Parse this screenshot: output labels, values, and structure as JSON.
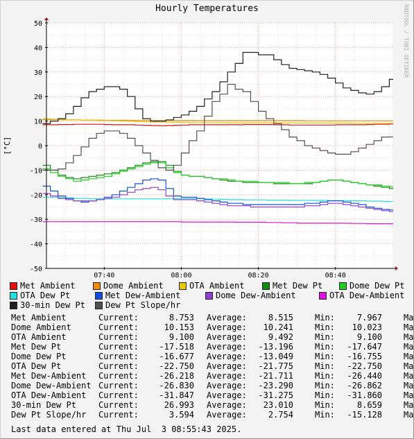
{
  "title": "Hourly Temperatures",
  "credit": "RRDTOOL / TOBI OETIKER",
  "ylabel": "[°C]",
  "colors": {
    "background": "#f3f3f3",
    "plot_background": "#ffffff",
    "grid_major": "#f0a8a8",
    "grid_minor": "#e0e0e0",
    "axis": "#000000",
    "arrow": "#a01010"
  },
  "chart_data": {
    "type": "line",
    "title": "Hourly Temperatures",
    "ylabel": "[°C]",
    "ylim": [
      -50,
      50
    ],
    "yticks": [
      50,
      40,
      30,
      20,
      10,
      0,
      -10,
      -20,
      -30,
      -40,
      -50
    ],
    "xrange": [
      "07:25",
      "08:55"
    ],
    "xticks": [
      "07:40",
      "08:00",
      "08:20",
      "08:40"
    ],
    "grid": true,
    "x": [
      "07:25",
      "07:27",
      "07:29",
      "07:31",
      "07:33",
      "07:35",
      "07:37",
      "07:39",
      "07:41",
      "07:43",
      "07:45",
      "07:47",
      "07:49",
      "07:51",
      "07:53",
      "07:55",
      "07:57",
      "07:59",
      "08:01",
      "08:03",
      "08:05",
      "08:07",
      "08:09",
      "08:11",
      "08:13",
      "08:15",
      "08:17",
      "08:19",
      "08:21",
      "08:23",
      "08:25",
      "08:27",
      "08:29",
      "08:31",
      "08:33",
      "08:35",
      "08:37",
      "08:39",
      "08:41",
      "08:43",
      "08:45",
      "08:47",
      "08:49",
      "08:51",
      "08:53",
      "08:55"
    ],
    "series": [
      {
        "name": "Met Ambient",
        "color": "#e01010",
        "values": [
          8.5,
          8.5,
          8.6,
          8.6,
          8.7,
          8.7,
          8.7,
          8.7,
          8.6,
          8.5,
          8.5,
          8.5,
          8.4,
          8.3,
          8.2,
          8.1,
          8.2,
          8.3,
          8.4,
          8.5,
          8.5,
          8.5,
          8.5,
          8.5,
          8.5,
          8.5,
          8.6,
          8.6,
          8.6,
          8.6,
          8.5,
          8.5,
          8.4,
          8.4,
          8.4,
          8.4,
          8.4,
          8.4,
          8.5,
          8.5,
          8.5,
          8.5,
          8.6,
          8.7,
          8.7,
          8.8
        ]
      },
      {
        "name": "Dome Ambient",
        "color": "#f08a10",
        "values": [
          10.6,
          10.6,
          10.5,
          10.5,
          10.5,
          10.4,
          10.4,
          10.4,
          10.3,
          10.3,
          10.3,
          10.3,
          10.2,
          10.2,
          10.2,
          10.2,
          10.2,
          10.2,
          10.2,
          10.2,
          10.2,
          10.2,
          10.2,
          10.2,
          10.2,
          10.2,
          10.2,
          10.2,
          10.2,
          10.2,
          10.2,
          10.2,
          10.2,
          10.2,
          10.1,
          10.1,
          10.1,
          10.1,
          10.1,
          10.1,
          10.1,
          10.1,
          10.1,
          10.1,
          10.1,
          10.1
        ]
      },
      {
        "name": "OTA Ambient",
        "color": "#e8c800",
        "values": [
          10.9,
          10.8,
          10.7,
          10.6,
          10.5,
          10.4,
          10.3,
          10.2,
          10.2,
          10.1,
          10.0,
          9.9,
          9.8,
          9.7,
          9.6,
          9.6,
          9.5,
          9.5,
          9.5,
          9.4,
          9.4,
          9.4,
          9.4,
          9.4,
          9.3,
          9.3,
          9.3,
          9.3,
          9.3,
          9.3,
          9.3,
          9.3,
          9.3,
          9.2,
          9.2,
          9.2,
          9.2,
          9.2,
          9.2,
          9.2,
          9.1,
          9.1,
          9.1,
          9.1,
          9.1,
          9.1
        ]
      },
      {
        "name": "Met Dew Pt",
        "color": "#108a10",
        "values": [
          -8.0,
          -10.0,
          -12.0,
          -13.0,
          -13.5,
          -13.0,
          -12.5,
          -12.0,
          -11.5,
          -11.0,
          -10.0,
          -9.0,
          -8.0,
          -7.0,
          -6.5,
          -6.5,
          -8.0,
          -10.5,
          -12.0,
          -12.5,
          -12.5,
          -13.0,
          -13.5,
          -14.0,
          -14.5,
          -14.5,
          -15.0,
          -15.0,
          -15.0,
          -15.0,
          -15.5,
          -15.5,
          -15.5,
          -15.5,
          -15.5,
          -15.0,
          -14.5,
          -14.0,
          -14.0,
          -14.5,
          -15.0,
          -15.5,
          -16.0,
          -16.5,
          -17.0,
          -17.5
        ]
      },
      {
        "name": "Dome Dew Pt",
        "color": "#20d020",
        "values": [
          -9.5,
          -11.0,
          -12.5,
          -13.5,
          -14.5,
          -14.0,
          -13.5,
          -13.0,
          -12.5,
          -11.5,
          -10.5,
          -9.5,
          -8.5,
          -7.5,
          -7.0,
          -7.0,
          -9.0,
          -11.0,
          -12.0,
          -12.5,
          -12.5,
          -13.0,
          -13.5,
          -13.5,
          -14.0,
          -14.5,
          -14.5,
          -14.5,
          -15.0,
          -15.0,
          -15.0,
          -15.0,
          -15.5,
          -15.5,
          -15.0,
          -15.0,
          -14.5,
          -14.0,
          -14.0,
          -14.5,
          -15.0,
          -15.5,
          -16.0,
          -16.0,
          -16.5,
          -16.7
        ]
      },
      {
        "name": "OTA Dew Pt",
        "color": "#20e0e0",
        "values": [
          -21.0,
          -21.0,
          -21.2,
          -21.3,
          -21.5,
          -21.5,
          -21.6,
          -21.6,
          -21.7,
          -21.7,
          -21.7,
          -21.7,
          -21.7,
          -21.7,
          -21.7,
          -21.7,
          -21.6,
          -21.6,
          -21.5,
          -21.5,
          -21.6,
          -21.7,
          -21.8,
          -21.9,
          -22.0,
          -22.0,
          -22.1,
          -22.1,
          -22.1,
          -22.2,
          -22.2,
          -22.2,
          -22.3,
          -22.3,
          -22.3,
          -22.3,
          -22.3,
          -22.4,
          -22.4,
          -22.4,
          -22.5,
          -22.5,
          -22.6,
          -22.6,
          -22.7,
          -22.8
        ]
      },
      {
        "name": "Met Dew-Ambient",
        "color": "#1050e0",
        "values": [
          -16.5,
          -18.5,
          -20.5,
          -21.5,
          -22.5,
          -23.0,
          -22.5,
          -22.0,
          -21.0,
          -20.0,
          -18.5,
          -17.0,
          -15.5,
          -14.0,
          -13.5,
          -14.0,
          -17.5,
          -20.5,
          -21.0,
          -21.0,
          -21.5,
          -22.0,
          -22.5,
          -23.0,
          -23.5,
          -23.5,
          -24.0,
          -24.0,
          -24.0,
          -24.0,
          -24.0,
          -24.0,
          -24.0,
          -24.0,
          -23.5,
          -23.5,
          -23.0,
          -22.5,
          -22.5,
          -23.0,
          -23.5,
          -24.0,
          -25.0,
          -25.5,
          -26.0,
          -26.2
        ]
      },
      {
        "name": "Dome Dew-Ambient",
        "color": "#9040d0",
        "values": [
          -19.5,
          -20.5,
          -21.5,
          -22.0,
          -22.5,
          -22.5,
          -22.5,
          -22.0,
          -21.5,
          -21.0,
          -20.0,
          -19.0,
          -18.0,
          -17.5,
          -17.0,
          -18.0,
          -20.5,
          -22.0,
          -22.0,
          -22.0,
          -22.5,
          -23.0,
          -23.5,
          -24.0,
          -24.5,
          -24.5,
          -24.5,
          -25.0,
          -25.0,
          -25.0,
          -25.0,
          -25.0,
          -25.0,
          -25.0,
          -24.5,
          -24.5,
          -24.0,
          -23.5,
          -23.5,
          -24.0,
          -24.5,
          -25.0,
          -25.5,
          -26.0,
          -26.5,
          -26.8
        ]
      },
      {
        "name": "OTA Dew-Ambient",
        "color": "#e010e0",
        "values": [
          -31.0,
          -31.0,
          -31.0,
          -31.0,
          -31.0,
          -31.0,
          -31.0,
          -31.0,
          -31.0,
          -31.0,
          -31.0,
          -31.0,
          -31.0,
          -31.0,
          -31.0,
          -31.0,
          -31.0,
          -31.0,
          -31.1,
          -31.1,
          -31.1,
          -31.1,
          -31.1,
          -31.1,
          -31.1,
          -31.2,
          -31.2,
          -31.2,
          -31.2,
          -31.3,
          -31.3,
          -31.4,
          -31.4,
          -31.6,
          -31.6,
          -31.6,
          -31.6,
          -31.6,
          -31.6,
          -31.6,
          -31.7,
          -31.7,
          -31.8,
          -31.8,
          -31.8,
          -31.8
        ]
      },
      {
        "name": "30-min Dew Pt",
        "color": "#202020",
        "values": [
          9.0,
          10.0,
          11.0,
          13.0,
          16.0,
          19.5,
          22.0,
          23.0,
          24.0,
          24.0,
          23.0,
          20.0,
          15.0,
          11.0,
          10.0,
          10.0,
          10.5,
          11.5,
          12.5,
          14.0,
          16.0,
          19.0,
          22.0,
          26.0,
          30.0,
          33.5,
          38.0,
          38.0,
          37.0,
          37.0,
          35.0,
          33.0,
          31.5,
          31.0,
          30.5,
          30.0,
          29.0,
          27.5,
          25.5,
          23.5,
          22.5,
          21.5,
          21.0,
          22.0,
          24.0,
          27.0
        ]
      },
      {
        "name": "Dew Pt Slope/hr",
        "color": "#505050",
        "values": [
          -10.0,
          -10.0,
          -9.5,
          -7.0,
          -4.0,
          -0.5,
          3.0,
          5.0,
          6.0,
          6.0,
          5.0,
          3.0,
          0.0,
          -3.0,
          -6.0,
          -9.0,
          -10.0,
          -8.0,
          -3.0,
          2.0,
          6.0,
          12.0,
          18.0,
          21.0,
          25.0,
          23.0,
          22.0,
          18.0,
          14.0,
          11.0,
          9.0,
          6.5,
          3.5,
          2.0,
          0.0,
          -1.0,
          -2.0,
          -3.0,
          -3.5,
          -3.5,
          -2.5,
          -1.0,
          0.5,
          2.0,
          3.5,
          3.6
        ]
      }
    ]
  },
  "legend": [
    {
      "label": "Met Ambient",
      "color": "#e01010"
    },
    {
      "label": "Dome Ambient",
      "color": "#f08a10"
    },
    {
      "label": "OTA Ambient",
      "color": "#e8c800"
    },
    {
      "label": "Met Dew Pt",
      "color": "#108a10"
    },
    {
      "label": "Dome Dew Pt",
      "color": "#20d020"
    },
    {
      "label": "OTA Dew Pt",
      "color": "#20e0e0"
    },
    {
      "label": "Met Dew-Ambient",
      "color": "#1050e0"
    },
    {
      "label": "Dome Dew-Ambient",
      "color": "#9040d0"
    },
    {
      "label": "OTA Dew-Ambient",
      "color": "#e010e0"
    },
    {
      "label": "30-min Dew Pt",
      "color": "#202020"
    },
    {
      "label": "Dew Pt Slope/hr",
      "color": "#505050"
    }
  ],
  "stats": {
    "labels": {
      "current": "Current:",
      "average": "Average:",
      "min": "Min:",
      "max": "Ma"
    },
    "rows": [
      {
        "name": "Met Ambient",
        "current": "8.753",
        "average": "8.515",
        "min": "7.967"
      },
      {
        "name": "Dome Ambient",
        "current": "10.153",
        "average": "10.241",
        "min": "10.023"
      },
      {
        "name": "OTA Ambient",
        "current": "9.100",
        "average": "9.492",
        "min": "9.100"
      },
      {
        "name": "Met Dew Pt",
        "current": "-17.518",
        "average": "-13.196",
        "min": "-17.647"
      },
      {
        "name": "Dome Dew Pt",
        "current": "-16.677",
        "average": "-13.049",
        "min": "-16.755"
      },
      {
        "name": "OTA Dew Pt",
        "current": "-22.750",
        "average": "-21.775",
        "min": "-22.750"
      },
      {
        "name": "Met Dew-Ambient",
        "current": "-26.218",
        "average": "-21.711",
        "min": "-26.440"
      },
      {
        "name": "Dome Dew-Ambient",
        "current": "-26.830",
        "average": "-23.290",
        "min": "-26.862"
      },
      {
        "name": "OTA Dew-Ambient",
        "current": "-31.847",
        "average": "-31.275",
        "min": "-31.860"
      },
      {
        "name": "30-min Dew Pt",
        "current": "26.993",
        "average": "23.010",
        "min": "8.659"
      },
      {
        "name": "Dew Pt Slope/hr",
        "current": "3.594",
        "average": "2.754",
        "min": "-15.128"
      }
    ]
  },
  "last_entry": "Last data entered at Thu Jul  3 08:55:43 2025."
}
